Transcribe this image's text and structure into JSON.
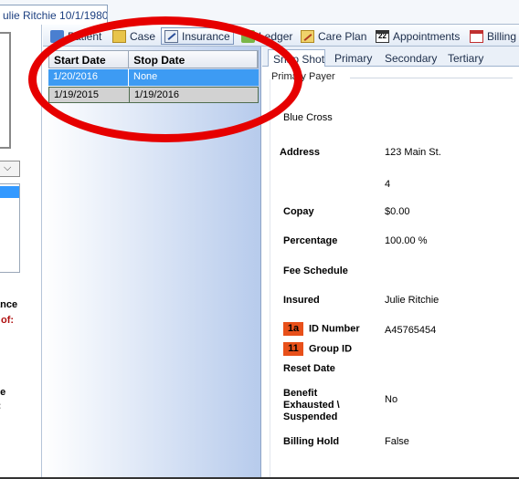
{
  "window": {
    "title_tab": "ulie Ritchie 10/1/1980"
  },
  "left_pane": {
    "labels": [
      "ance",
      "of:",
      "",
      "ce",
      "t:"
    ]
  },
  "toolbar": {
    "tabs": [
      {
        "label": "Patient",
        "icon": "patient-icon"
      },
      {
        "label": "Case",
        "icon": "case-icon"
      },
      {
        "label": "Insurance",
        "icon": "insurance-icon",
        "active": true
      },
      {
        "label": "Ledger",
        "icon": "ledger-icon"
      },
      {
        "label": "Care Plan",
        "icon": "care-plan-icon"
      },
      {
        "label": "Appointments",
        "icon": "appointments-icon"
      },
      {
        "label": "Billing",
        "icon": "billing-icon"
      }
    ],
    "appointments_icon_text": "22"
  },
  "insurance_grid": {
    "columns": [
      "Start Date",
      "Stop Date"
    ],
    "rows": [
      {
        "start": "1/20/2016",
        "stop": "None",
        "selected": true
      },
      {
        "start": "1/19/2015",
        "stop": "1/19/2016",
        "selected": false
      }
    ]
  },
  "detail": {
    "subtabs": [
      "Snap Shot",
      "Primary",
      "Secondary",
      "Tertiary"
    ],
    "active_subtab": "Snap Shot",
    "section_title": "Primary Payer",
    "payer_name": "Blue Cross",
    "fields": {
      "address_label": "Address",
      "address_line1": "123 Main St.",
      "address_line2": "4",
      "copay_label": "Copay",
      "copay_value": "$0.00",
      "percentage_label": "Percentage",
      "percentage_value": "100.00 %",
      "fee_schedule_label": "Fee Schedule",
      "insured_label": "Insured",
      "insured_value": "Julie Ritchie",
      "id_number_badge": "1a",
      "id_number_label": "ID Number",
      "id_number_value": "A45765454",
      "group_id_badge": "11",
      "group_id_label": "Group ID",
      "reset_date_label": "Reset Date",
      "benefit_label_1": "Benefit",
      "benefit_label_2": "Exhausted \\",
      "benefit_label_3": "Suspended",
      "benefit_value": "No",
      "billing_hold_label": "Billing Hold",
      "billing_hold_value": "False"
    }
  },
  "colors": {
    "selection_blue": "#3d9bf3",
    "annotation_red": "#e60000",
    "badge_orange": "#e8501a"
  }
}
